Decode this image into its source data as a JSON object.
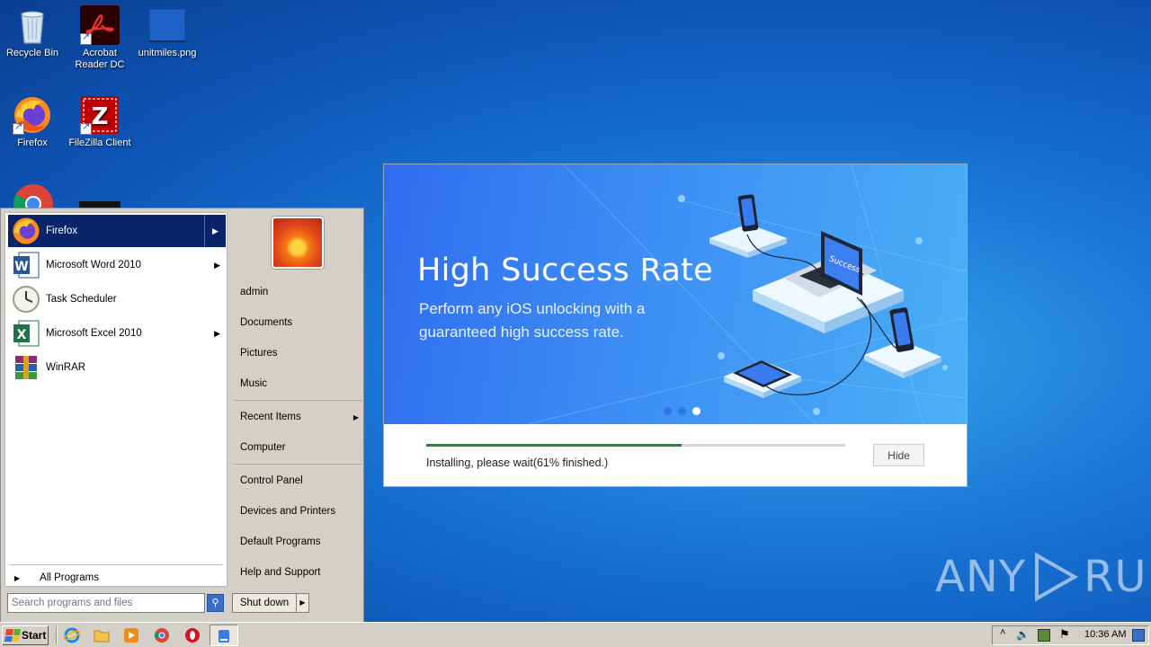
{
  "desktop": {
    "icons": [
      {
        "label": "Recycle Bin"
      },
      {
        "label": "Acrobat Reader DC"
      },
      {
        "label": "unitmiles.png"
      },
      {
        "label": "Firefox"
      },
      {
        "label": "FileZilla Client"
      }
    ]
  },
  "installer": {
    "title": "High Success Rate",
    "subtitle": "Perform any iOS unlocking with a guaranteed high success rate.",
    "laptop_screen_text": "Success",
    "progress_fraction": 0.61,
    "status_text": "Installing, please wait(61% finished.)",
    "hide_label": "Hide",
    "carousel_dots": 3,
    "active_dot": 2
  },
  "start_menu": {
    "programs": [
      {
        "label": "Firefox",
        "has_submenu": true,
        "selected": true
      },
      {
        "label": "Microsoft Word 2010",
        "has_submenu": true
      },
      {
        "label": "Task Scheduler",
        "has_submenu": false
      },
      {
        "label": "Microsoft Excel 2010",
        "has_submenu": true
      },
      {
        "label": "WinRAR",
        "has_submenu": false
      }
    ],
    "all_programs_label": "All Programs",
    "search_placeholder": "Search programs and files",
    "right_items": {
      "admin": "admin",
      "documents": "Documents",
      "pictures": "Pictures",
      "music": "Music",
      "recent_items": "Recent Items",
      "computer": "Computer",
      "control_panel": "Control Panel",
      "devices_printers": "Devices and Printers",
      "default_programs": "Default Programs",
      "help_support": "Help and Support"
    },
    "shutdown_label": "Shut down"
  },
  "taskbar": {
    "start_label": "Start",
    "clock": "10:36 AM"
  },
  "watermark": {
    "text_left": "ANY",
    "text_right": "RUN"
  },
  "colors": {
    "desktop_blue": "#1a78d8",
    "menu_selection": "#0a246a",
    "progress_green": "#3c7a45",
    "banner_blue": "#3d8ef4"
  }
}
